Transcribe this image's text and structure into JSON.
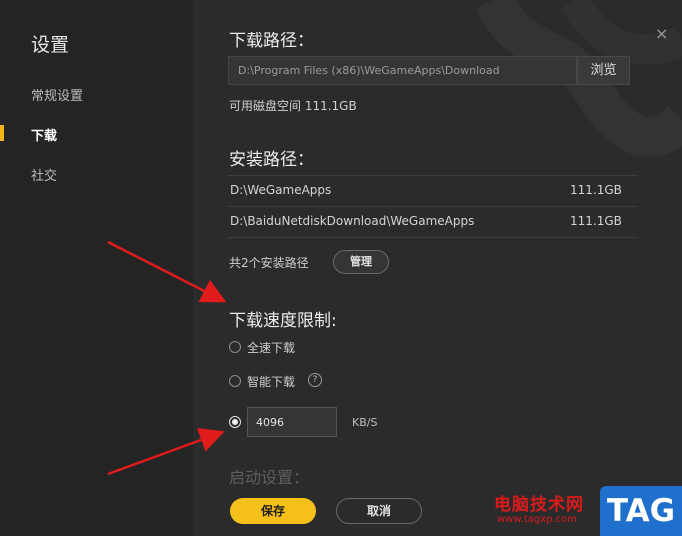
{
  "sidebar": {
    "title": "设置",
    "items": [
      {
        "label": "常规设置"
      },
      {
        "label": "下载"
      },
      {
        "label": "社交"
      }
    ]
  },
  "close_icon": "×",
  "download_path": {
    "title": "下载路径：",
    "value": "D:\\Program Files (x86)\\WeGameApps\\Download",
    "browse_label": "浏览",
    "disk_space": "可用磁盘空间 111.1GB"
  },
  "install_path": {
    "title": "安装路径：",
    "rows": [
      {
        "path": "D:\\WeGameApps",
        "size": "111.1GB"
      },
      {
        "path": "D:\\BaiduNetdiskDownload\\WeGameApps",
        "size": "111.1GB"
      }
    ],
    "count_text": "共2个安装路径",
    "manage_label": "管理"
  },
  "speed_limit": {
    "title": "下载速度限制:",
    "options": [
      {
        "label": "全速下载",
        "selected": false
      },
      {
        "label": "智能下载",
        "selected": false
      },
      {
        "label": "",
        "selected": true
      }
    ],
    "help_icon": "?",
    "value": "4096",
    "unit": "KB/S"
  },
  "startup": {
    "title": "启动设置："
  },
  "footer": {
    "save_label": "保存",
    "cancel_label": "取消"
  },
  "watermark": {
    "site_name": "电脑技术网",
    "url": "www.tagxp.com",
    "tag": "TAG"
  },
  "colors": {
    "accent": "#f5c019",
    "annotation_arrow": "#e01b1b",
    "tag_blue": "#1f6fcc"
  }
}
